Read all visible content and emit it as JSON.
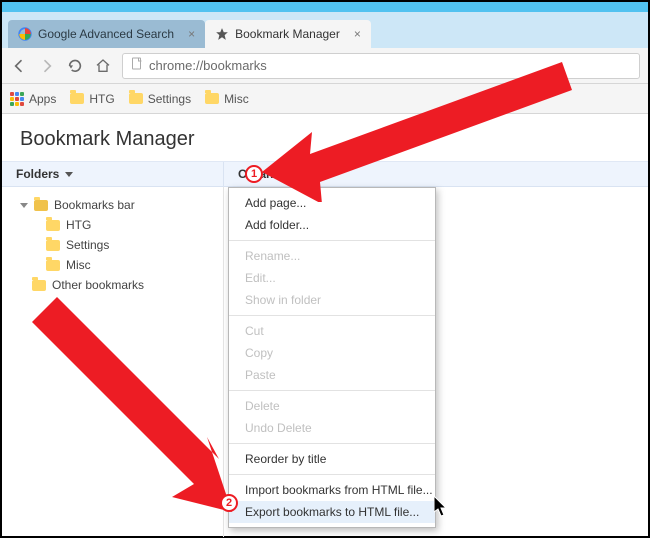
{
  "tabs": [
    {
      "label": "Google Advanced Search",
      "active": false
    },
    {
      "label": "Bookmark Manager",
      "active": true
    }
  ],
  "omnibox": {
    "url": "chrome://bookmarks"
  },
  "bookmarks_bar": {
    "apps_label": "Apps",
    "items": [
      "HTG",
      "Settings",
      "Misc"
    ]
  },
  "page": {
    "title": "Bookmark Manager"
  },
  "headers": {
    "folders": "Folders",
    "organize": "Organize"
  },
  "tree": {
    "root": "Bookmarks bar",
    "children": [
      "HTG",
      "Settings",
      "Misc"
    ],
    "other": "Other bookmarks"
  },
  "menu": {
    "add_page": "Add page...",
    "add_folder": "Add folder...",
    "rename": "Rename...",
    "edit": "Edit...",
    "show_in_folder": "Show in folder",
    "cut": "Cut",
    "copy": "Copy",
    "paste": "Paste",
    "delete": "Delete",
    "undo_delete": "Undo Delete",
    "reorder": "Reorder by title",
    "import": "Import bookmarks from HTML file...",
    "export": "Export bookmarks to HTML file..."
  },
  "markers": {
    "one": "1",
    "two": "2"
  },
  "apps_colors": [
    "#e04a3f",
    "#4688f1",
    "#3da758",
    "#fbbc05",
    "#e04a3f",
    "#4688f1",
    "#3da758",
    "#fbbc05",
    "#e04a3f"
  ]
}
